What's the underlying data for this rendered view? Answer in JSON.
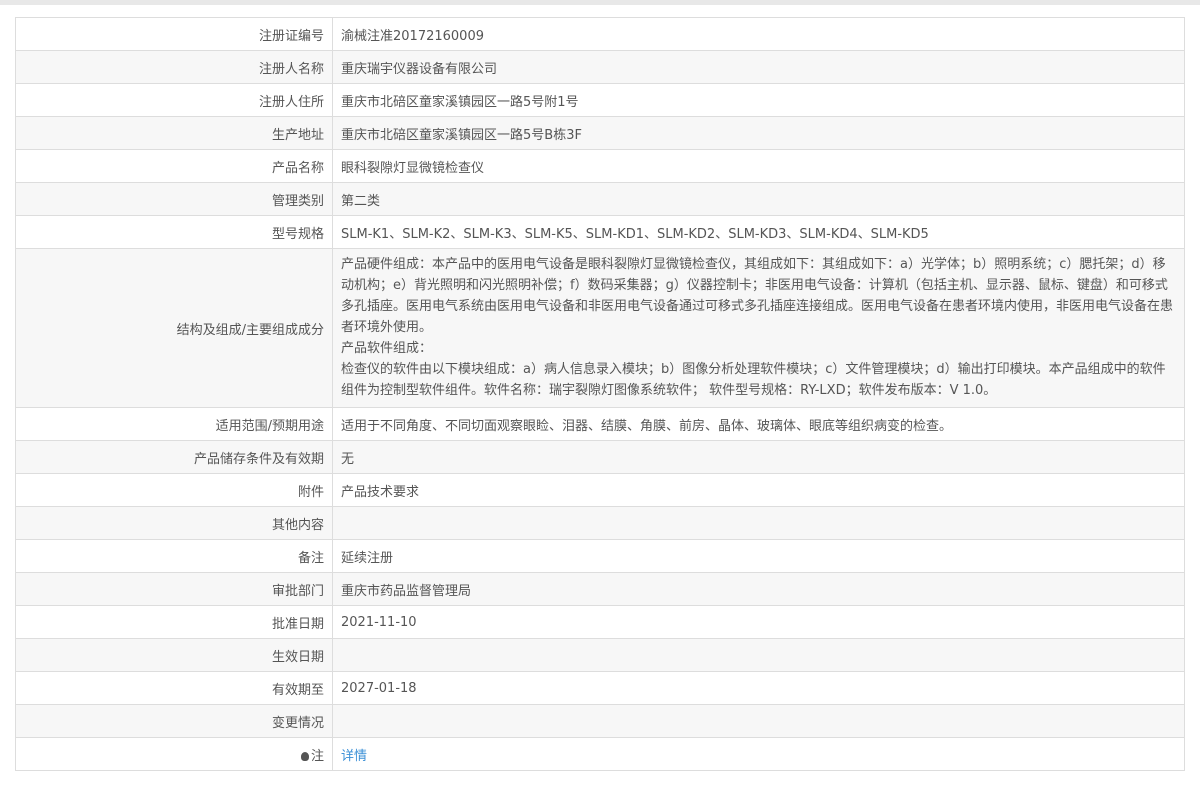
{
  "rows": [
    {
      "label": "注册证编号",
      "value": "渝械注准20172160009"
    },
    {
      "label": "注册人名称",
      "value": "重庆瑞宇仪器设备有限公司"
    },
    {
      "label": "注册人住所",
      "value": "重庆市北碚区童家溪镇园区一路5号附1号"
    },
    {
      "label": "生产地址",
      "value": "重庆市北碚区童家溪镇园区一路5号B栋3F"
    },
    {
      "label": "产品名称",
      "value": "眼科裂隙灯显微镜检查仪"
    },
    {
      "label": "管理类别",
      "value": "第二类"
    },
    {
      "label": "型号规格",
      "value": "SLM-K1、SLM-K2、SLM-K3、SLM-K5、SLM-KD1、SLM-KD2、SLM-KD3、SLM-KD4、SLM-KD5"
    }
  ],
  "structure": {
    "label": "结构及组成/主要组成成分",
    "lines": [
      "产品硬件组成：本产品中的医用电气设备是眼科裂隙灯显微镜检查仪，其组成如下：其组成如下：a）光学体；b）照明系统；c）腮托架；d）移动机构；e）背光照明和闪光照明补偿；f）数码采集器；g）仪器控制卡；非医用电气设备：计算机（包括主机、显示器、鼠标、键盘）和可移式多孔插座。医用电气系统由医用电气设备和非医用电气设备通过可移式多孔插座连接组成。医用电气设备在患者环境内使用，非医用电气设备在患者环境外使用。",
      "产品软件组成：",
      "检查仪的软件由以下模块组成：a）病人信息录入模块；b）图像分析处理软件模块；c）文件管理模块；d）输出打印模块。本产品组成中的软件组件为控制型软件组件。软件名称：瑞宇裂隙灯图像系统软件； 软件型号规格：RY-LXD；软件发布版本：V 1.0。"
    ]
  },
  "rows2": [
    {
      "label": "适用范围/预期用途",
      "value": "适用于不同角度、不同切面观察眼睑、泪器、结膜、角膜、前房、晶体、玻璃体、眼底等组织病变的检查。"
    },
    {
      "label": "产品储存条件及有效期",
      "value": "无"
    },
    {
      "label": "附件",
      "value": "产品技术要求"
    },
    {
      "label": "其他内容",
      "value": ""
    },
    {
      "label": "备注",
      "value": "延续注册"
    },
    {
      "label": "审批部门",
      "value": "重庆市药品监督管理局"
    },
    {
      "label": "批准日期",
      "value": "2021-11-10"
    },
    {
      "label": "生效日期",
      "value": ""
    },
    {
      "label": "有效期至",
      "value": "2027-01-18"
    },
    {
      "label": "变更情况",
      "value": ""
    }
  ],
  "note": {
    "label": "注",
    "link": "详情",
    "icon": "lightbulb-icon"
  }
}
